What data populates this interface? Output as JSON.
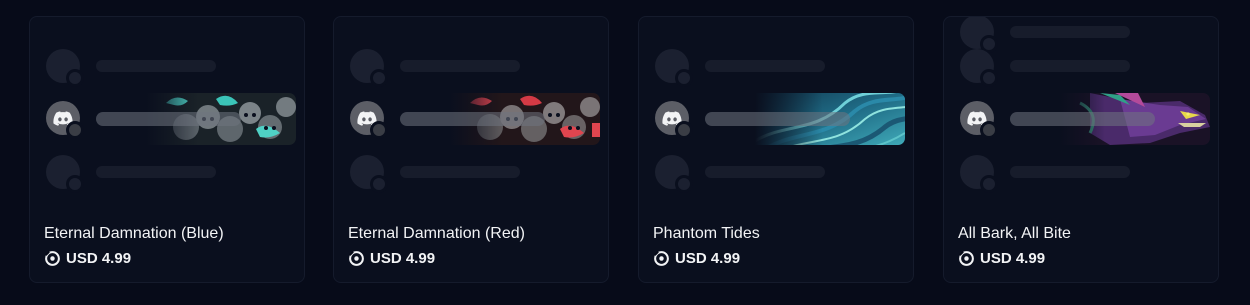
{
  "items": [
    {
      "title": "Eternal Damnation (Blue)",
      "price": "USD 4.99",
      "theme": "skulls-teal",
      "accent": "#4fd1c5"
    },
    {
      "title": "Eternal Damnation (Red)",
      "price": "USD 4.99",
      "theme": "skulls-red",
      "accent": "#e0454f"
    },
    {
      "title": "Phantom Tides",
      "price": "USD 4.99",
      "theme": "waves-teal",
      "accent": "#3aa6c4"
    },
    {
      "title": "All Bark, All Bite",
      "price": "USD 4.99",
      "theme": "dragon-purple",
      "accent": "#7b3fa8"
    }
  ],
  "icons": {
    "avatar": "discord-logo-icon",
    "price": "orb-currency-icon"
  },
  "colors": {
    "background": "#070b19",
    "card": "#0a0f1e",
    "text": "#f2f3f5"
  }
}
